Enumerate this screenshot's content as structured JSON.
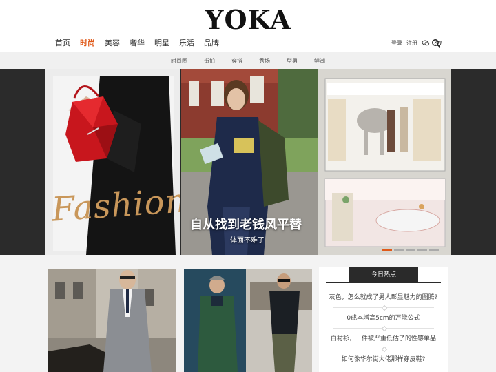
{
  "brand": {
    "logo": "YOKA"
  },
  "main_nav": [
    "首页",
    "时尚",
    "美容",
    "奢华",
    "明星",
    "乐活",
    "品牌"
  ],
  "active_nav": "时尚",
  "user_links": {
    "login": "登录",
    "register": "注册"
  },
  "sub_nav": [
    "时尚圈",
    "街拍",
    "穿搭",
    "秀场",
    "型男",
    "鲜潮"
  ],
  "hero": {
    "script_text": "Fashion",
    "title": "自从找到老钱风平替",
    "subtitle": "体面不难了"
  },
  "hot": {
    "tab": "今日热点",
    "items": [
      "灰色，怎么就成了男人彰显魅力的图腾?",
      "0成本增高5cm的万能公式",
      "白衬衫，一件被严重低估了的性感单品",
      "如何像华尔街大佬那样穿皮鞋?"
    ]
  },
  "colors": {
    "accent": "#e05a1a",
    "dark": "#2a2a2a"
  }
}
